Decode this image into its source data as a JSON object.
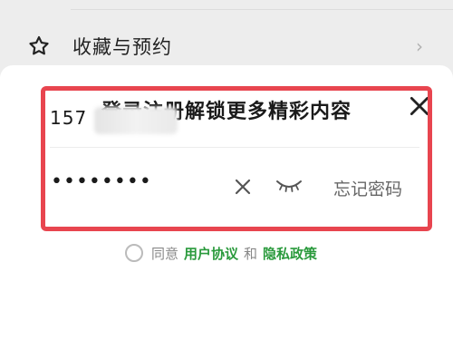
{
  "background_item": {
    "label": "收藏与预约",
    "icon": "star-icon",
    "chevron": "›"
  },
  "sheet": {
    "title": "登录注册解锁更多精彩内容",
    "close_icon": "close-icon",
    "phone_value": "157",
    "password_mask": "••••••••",
    "forgot_password": "忘记密码",
    "clear_icon": "clear-icon",
    "eye_icon": "eye-closed-icon",
    "agreement": {
      "prefix": "同意",
      "user_agreement": "用户协议",
      "and": "和",
      "privacy_policy": "隐私政策"
    }
  },
  "colors": {
    "accent_green": "#2a9a3c",
    "highlight_red": "#e8454f"
  }
}
